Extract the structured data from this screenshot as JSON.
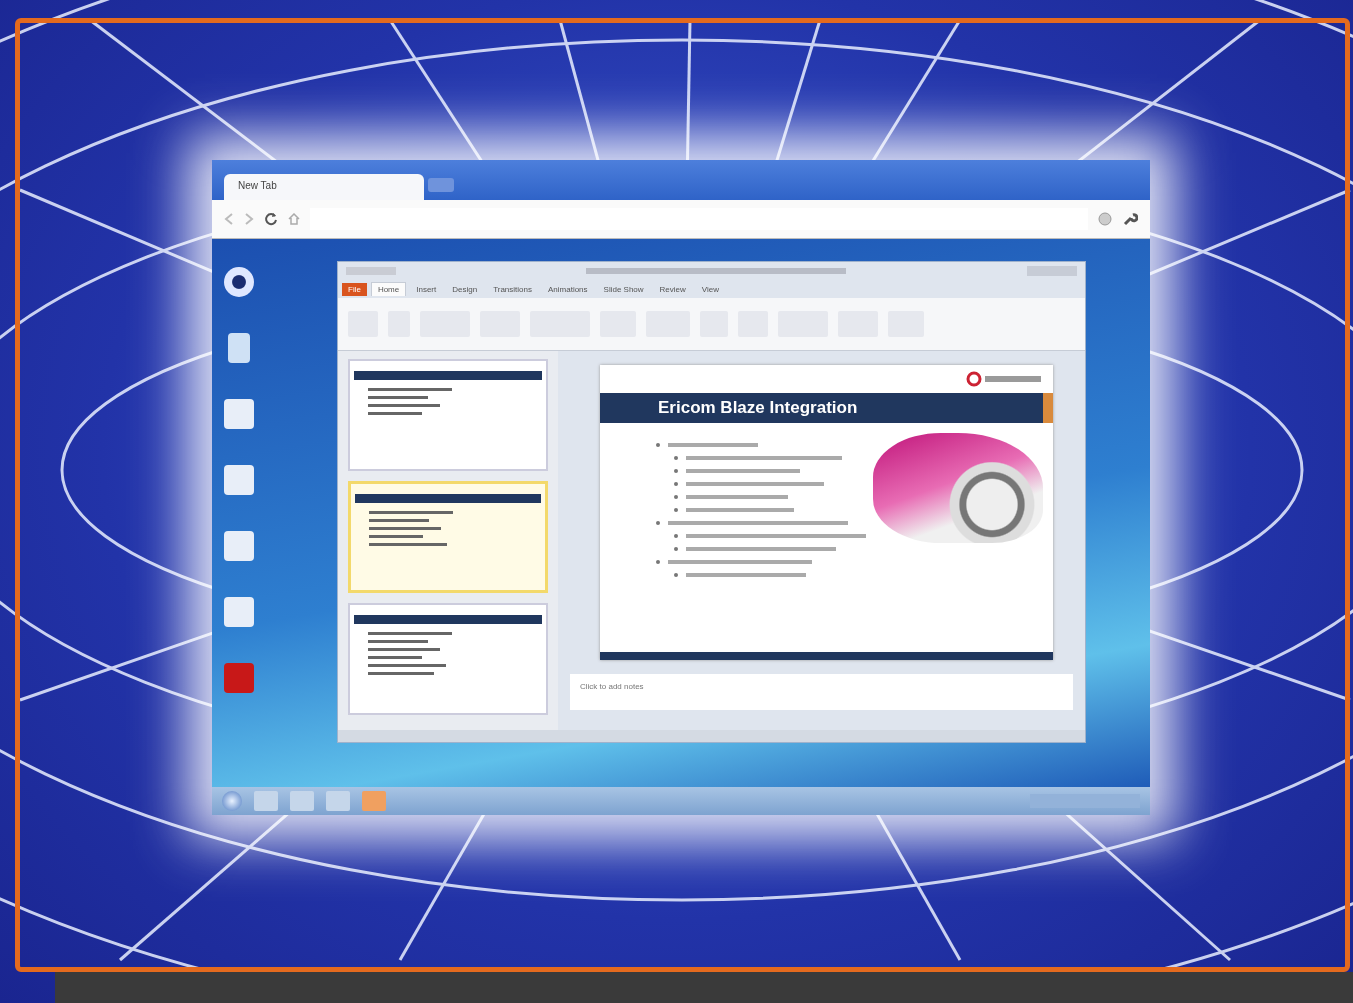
{
  "browser": {
    "tabs": [
      {
        "title": "New Tab",
        "selected": true
      }
    ]
  },
  "presentation": {
    "ribbon_tabs": [
      {
        "label": "File",
        "selected": false
      },
      {
        "label": "Home",
        "selected": true
      },
      {
        "label": "Insert",
        "selected": false
      },
      {
        "label": "Design",
        "selected": false
      },
      {
        "label": "Transitions",
        "selected": false
      },
      {
        "label": "Animations",
        "selected": false
      },
      {
        "label": "Slide Show",
        "selected": false
      },
      {
        "label": "Review",
        "selected": false
      },
      {
        "label": "View",
        "selected": false
      }
    ],
    "slides": [
      {
        "selected": false
      },
      {
        "selected": true
      },
      {
        "selected": false
      }
    ],
    "slide": {
      "title": "Ericom Blaze Integration"
    },
    "notes": {
      "placeholder": "Click to add notes"
    }
  }
}
